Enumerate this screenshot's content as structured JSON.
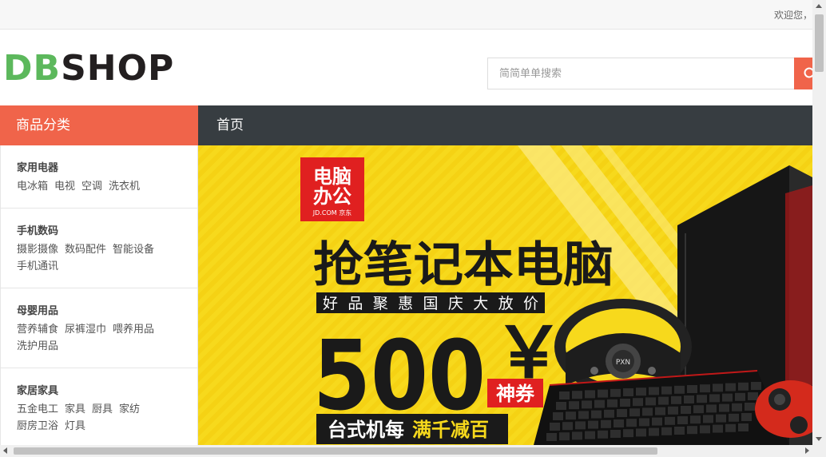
{
  "topbar": {
    "welcome": "欢迎您，"
  },
  "logo": {
    "part1": "DB",
    "part2": "SHOP"
  },
  "search": {
    "placeholder": "简简单单搜索"
  },
  "nav": {
    "category_title": "商品分类",
    "home": "首页"
  },
  "categories": [
    {
      "title": "家用电器",
      "items": [
        "电冰箱",
        "电视",
        "空调",
        "洗衣机"
      ]
    },
    {
      "title": "手机数码",
      "items": [
        "摄影摄像",
        "数码配件",
        "智能设备",
        "手机通讯"
      ]
    },
    {
      "title": "母婴用品",
      "items": [
        "营养辅食",
        "尿裤湿巾",
        "喂养用品",
        "洗护用品"
      ]
    },
    {
      "title": "家居家具",
      "items": [
        "五金电工",
        "家具",
        "厨具",
        "家纺",
        "厨房卫浴",
        "灯具"
      ]
    }
  ],
  "banner": {
    "badge_line1": "电脑",
    "badge_line2": "办公",
    "badge_small": "JD.COM 京东",
    "headline": "抢笔记本电脑",
    "tagline": "好品聚惠国庆大放价",
    "amount": "500",
    "currency": "￥",
    "coupon": "神券",
    "bottom_prefix": "台式机每",
    "bottom_highlight": "满千减百",
    "brand_mark": "PXN",
    "colors": {
      "bg": "#f7d91c",
      "red": "#e02020",
      "black": "#1a1a1a"
    }
  },
  "colors": {
    "accent": "#f0644a",
    "nav_dark": "#373d41",
    "logo_green": "#5cb85c"
  }
}
